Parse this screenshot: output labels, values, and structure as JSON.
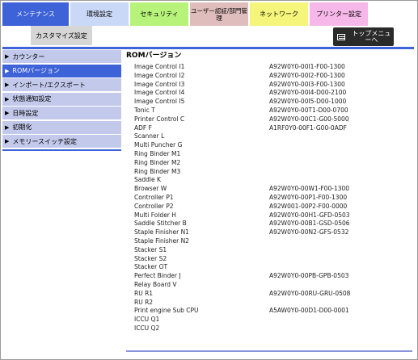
{
  "tabs": [
    {
      "label": "メンテナンス"
    },
    {
      "label": "環境設定"
    },
    {
      "label": "セキュリティ"
    },
    {
      "label": "ユーザー認証/部門管理"
    },
    {
      "label": "ネットワーク"
    },
    {
      "label": "プリンター設定"
    }
  ],
  "subtab": {
    "label": "カスタマイズ設定"
  },
  "topmenu": {
    "label": "トップメニューへ"
  },
  "sidebar": {
    "items": [
      {
        "label": "カウンター"
      },
      {
        "label": "ROMバージョン"
      },
      {
        "label": "インポート/エクスポート"
      },
      {
        "label": "状態通知設定"
      },
      {
        "label": "日時設定"
      },
      {
        "label": "初期化"
      },
      {
        "label": "メモリースイッチ設定"
      }
    ]
  },
  "main": {
    "title": "ROMバージョン",
    "rows": [
      {
        "name": "Image Control I1",
        "value": "A92W0Y0-00I1-F00-1300"
      },
      {
        "name": "Image Control I2",
        "value": "A92W0Y0-00I2-F00-1300"
      },
      {
        "name": "Image Control I3",
        "value": "A92W0Y0-00I3-F00-1300"
      },
      {
        "name": "Image Control I4",
        "value": "A92W0Y0-00I4-D00-2100"
      },
      {
        "name": "Image Control I5",
        "value": "A92W0Y0-00I5-D00-1000"
      },
      {
        "name": "Tonic T",
        "value": "A92W0Y0-00T1-D00-0700"
      },
      {
        "name": "Printer Control C",
        "value": "A92W0Y0-00C1-G00-5000"
      },
      {
        "name": "ADF F",
        "value": "A1RF0Y0-00F1-G00-0ADF"
      },
      {
        "name": "Scanner L",
        "value": ""
      },
      {
        "name": "Multi Puncher G",
        "value": ""
      },
      {
        "name": "Ring Binder M1",
        "value": ""
      },
      {
        "name": "Ring Binder M2",
        "value": ""
      },
      {
        "name": "Ring Binder M3",
        "value": ""
      },
      {
        "name": "Saddle K",
        "value": ""
      },
      {
        "name": "Browser W",
        "value": "A92W0Y0-00W1-F00-1300"
      },
      {
        "name": "Controller P1",
        "value": "A92W0Y0-00P1-F00-1300"
      },
      {
        "name": "Controller P2",
        "value": "A92W001-00P2-F00-0000"
      },
      {
        "name": "Multi Folder H",
        "value": "A92W0Y0-00H1-GFD-0503"
      },
      {
        "name": "Saddle Stitcher B",
        "value": "A92W0Y0-00B1-GSD-0506"
      },
      {
        "name": "Staple Finisher N1",
        "value": "A92W0Y0-00N2-GFS-0532"
      },
      {
        "name": "Staple Finisher N2",
        "value": ""
      },
      {
        "name": "Stacker S1",
        "value": ""
      },
      {
        "name": "Stacker S2",
        "value": ""
      },
      {
        "name": "Stacker OT",
        "value": ""
      },
      {
        "name": "Perfect Binder J",
        "value": "A92W0Y0-00PB-GPB-0503"
      },
      {
        "name": "Relay Board V",
        "value": ""
      },
      {
        "name": "RU R1",
        "value": "A92W0Y0-00RU-GRU-0508"
      },
      {
        "name": "RU R2",
        "value": ""
      },
      {
        "name": "Print engine Sub CPU",
        "value": "A5AW0Y0-00D1-D00-0001"
      },
      {
        "name": "ICCU Q1",
        "value": ""
      },
      {
        "name": "ICCU Q2",
        "value": ""
      }
    ]
  },
  "colors": {
    "accent": "#3e62d8",
    "sidebar_bg": "#c3c9eb"
  }
}
